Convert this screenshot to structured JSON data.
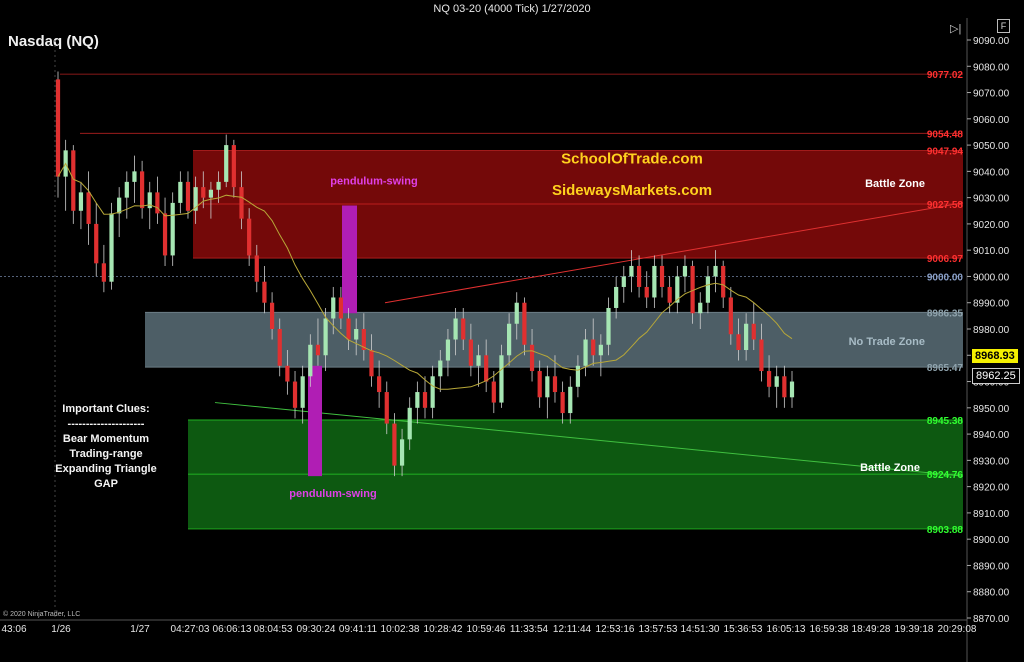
{
  "window_title": "NQ 03-20 (4000 Tick)  1/27/2020",
  "symbol_title": "Nasdaq (NQ)",
  "copyright": "© 2020 NinjaTrader, LLC",
  "header_button": "F",
  "brand": {
    "line1": "SchoolOfTrade.com",
    "line2": "SidewaysMarkets.com"
  },
  "clues": {
    "title": "Important Clues:",
    "divider": "---------------------",
    "items": [
      "Bear Momentum",
      "Trading-range",
      "Expanding Triangle",
      "GAP"
    ]
  },
  "current_prices": {
    "ma_value": "8968.93",
    "last_price": "8962.25"
  },
  "colors": {
    "background": "#000000",
    "bull_candle": "#a6e6b3",
    "bear_candle": "#e03030",
    "red_zone": "#7a0a0a",
    "gray_zone": "#5a6e78",
    "green_zone": "#0e5e12",
    "pendulum": "#b01eb4",
    "brand_text": "#ffd21e",
    "ma_line": "#b8a838"
  },
  "chart_data": {
    "type": "candlestick",
    "y_axis": {
      "min": 8870,
      "max": 9090,
      "step": 10
    },
    "y_ticks": [
      "9090.00",
      "9080.00",
      "9070.00",
      "9060.00",
      "9050.00",
      "9040.00",
      "9030.00",
      "9020.00",
      "9010.00",
      "9000.00",
      "8990.00",
      "8980.00",
      "8970.00",
      "8960.00",
      "8950.00",
      "8940.00",
      "8930.00",
      "8920.00",
      "8910.00",
      "8900.00",
      "8890.00",
      "8880.00",
      "8870.00"
    ],
    "x_labels": [
      "43:06",
      "1/26",
      "1/27",
      "04:27:03",
      "06:06:13",
      "08:04:53",
      "09:30:24",
      "09:41:11",
      "10:02:38",
      "10:28:42",
      "10:59:46",
      "11:33:54",
      "12:11:44",
      "12:53:16",
      "13:57:53",
      "14:51:30",
      "15:36:53",
      "16:05:13",
      "16:59:38",
      "18:49:28",
      "19:39:18",
      "20:29:08"
    ],
    "levels": [
      {
        "label": "9077.02",
        "value": 9077.02,
        "color": "#ff3030"
      },
      {
        "label": "9054.48",
        "value": 9054.48,
        "color": "#ff3030"
      },
      {
        "label": "9047.94",
        "value": 9047.94,
        "color": "#ff3030"
      },
      {
        "label": "9027.58",
        "value": 9027.58,
        "color": "#ff3030"
      },
      {
        "label": "9006.97",
        "value": 9006.97,
        "color": "#ff3030"
      },
      {
        "label": "9000.00",
        "value": 9000.0,
        "color": "#8aa0c8"
      },
      {
        "label": "8986.35",
        "value": 8986.35,
        "color": "#8fa3ad"
      },
      {
        "label": "8965.47",
        "value": 8965.47,
        "color": "#8fa3ad"
      },
      {
        "label": "8945.38",
        "value": 8945.38,
        "color": "#30ff30"
      },
      {
        "label": "8924.76",
        "value": 8924.76,
        "color": "#30ff30"
      },
      {
        "label": "8903.88",
        "value": 8903.88,
        "color": "#30ff30"
      }
    ],
    "zones": [
      {
        "name": "Battle Zone",
        "top": 9047.94,
        "bottom": 9006.97,
        "color": "#7a0a0a"
      },
      {
        "name": "No Trade Zone",
        "top": 8986.35,
        "bottom": 8965.47,
        "color": "#5a6e78"
      },
      {
        "name": "Battle Zone",
        "top": 8945.38,
        "bottom": 8903.88,
        "color": "#0e5e12"
      }
    ],
    "annotations": [
      "pendulum-swing",
      "pendulum-swing"
    ],
    "candles": [
      [
        9075,
        9078,
        9030,
        9038
      ],
      [
        9038,
        9052,
        9025,
        9048
      ],
      [
        9048,
        9050,
        9020,
        9025
      ],
      [
        9025,
        9036,
        9018,
        9032
      ],
      [
        9032,
        9040,
        9012,
        9020
      ],
      [
        9020,
        9028,
        9000,
        9005
      ],
      [
        9005,
        9012,
        8994,
        8998
      ],
      [
        8998,
        9028,
        8995,
        9024
      ],
      [
        9024,
        9034,
        9015,
        9030
      ],
      [
        9030,
        9040,
        9022,
        9036
      ],
      [
        9036,
        9046,
        9028,
        9040
      ],
      [
        9040,
        9044,
        9022,
        9026
      ],
      [
        9026,
        9036,
        9018,
        9032
      ],
      [
        9032,
        9038,
        9020,
        9024
      ],
      [
        9024,
        9030,
        9004,
        9008
      ],
      [
        9008,
        9032,
        9004,
        9028
      ],
      [
        9028,
        9040,
        9024,
        9036
      ],
      [
        9036,
        9040,
        9022,
        9025
      ],
      [
        9025,
        9038,
        9020,
        9034
      ],
      [
        9034,
        9040,
        9026,
        9030
      ],
      [
        9030,
        9036,
        9022,
        9033
      ],
      [
        9033,
        9040,
        9028,
        9036
      ],
      [
        9036,
        9054,
        9034,
        9050
      ],
      [
        9050,
        9052,
        9030,
        9034
      ],
      [
        9034,
        9040,
        9018,
        9022
      ],
      [
        9022,
        9026,
        9004,
        9008
      ],
      [
        9008,
        9012,
        8994,
        8998
      ],
      [
        8998,
        9004,
        8986,
        8990
      ],
      [
        8990,
        8994,
        8976,
        8980
      ],
      [
        8980,
        8984,
        8962,
        8966
      ],
      [
        8966,
        8972,
        8955,
        8960
      ],
      [
        8960,
        8964,
        8946,
        8950
      ],
      [
        8950,
        8966,
        8944,
        8962
      ],
      [
        8962,
        8978,
        8958,
        8974
      ],
      [
        8974,
        8984,
        8966,
        8970
      ],
      [
        8970,
        8988,
        8964,
        8984
      ],
      [
        8984,
        8996,
        8978,
        8992
      ],
      [
        8992,
        8996,
        8980,
        8984
      ],
      [
        8984,
        8988,
        8972,
        8976
      ],
      [
        8976,
        8984,
        8970,
        8980
      ],
      [
        8980,
        8986,
        8968,
        8972
      ],
      [
        8972,
        8978,
        8958,
        8962
      ],
      [
        8962,
        8968,
        8950,
        8956
      ],
      [
        8956,
        8960,
        8940,
        8944
      ],
      [
        8944,
        8948,
        8924,
        8928
      ],
      [
        8928,
        8942,
        8924,
        8938
      ],
      [
        8938,
        8954,
        8934,
        8950
      ],
      [
        8950,
        8960,
        8944,
        8956
      ],
      [
        8956,
        8962,
        8946,
        8950
      ],
      [
        8950,
        8966,
        8946,
        8962
      ],
      [
        8962,
        8972,
        8956,
        8968
      ],
      [
        8968,
        8980,
        8962,
        8976
      ],
      [
        8976,
        8988,
        8970,
        8984
      ],
      [
        8984,
        8988,
        8972,
        8976
      ],
      [
        8976,
        8982,
        8962,
        8966
      ],
      [
        8966,
        8974,
        8958,
        8970
      ],
      [
        8970,
        8976,
        8956,
        8960
      ],
      [
        8960,
        8964,
        8948,
        8952
      ],
      [
        8952,
        8974,
        8950,
        8970
      ],
      [
        8970,
        8986,
        8966,
        8982
      ],
      [
        8982,
        8994,
        8976,
        8990
      ],
      [
        8990,
        8992,
        8970,
        8974
      ],
      [
        8974,
        8980,
        8960,
        8964
      ],
      [
        8964,
        8968,
        8950,
        8954
      ],
      [
        8954,
        8966,
        8946,
        8962
      ],
      [
        8962,
        8970,
        8952,
        8956
      ],
      [
        8956,
        8960,
        8944,
        8948
      ],
      [
        8948,
        8962,
        8944,
        8958
      ],
      [
        8958,
        8970,
        8954,
        8966
      ],
      [
        8966,
        8980,
        8962,
        8976
      ],
      [
        8976,
        8984,
        8966,
        8970
      ],
      [
        8970,
        8978,
        8962,
        8974
      ],
      [
        8974,
        8992,
        8970,
        8988
      ],
      [
        8988,
        9000,
        8984,
        8996
      ],
      [
        8996,
        9004,
        8990,
        9000
      ],
      [
        9000,
        9010,
        8994,
        9004
      ],
      [
        9004,
        9008,
        8992,
        8996
      ],
      [
        8996,
        9002,
        8988,
        8992
      ],
      [
        8992,
        9008,
        8988,
        9004
      ],
      [
        9004,
        9008,
        8992,
        8996
      ],
      [
        8996,
        9000,
        8986,
        8990
      ],
      [
        8990,
        9004,
        8986,
        9000
      ],
      [
        9000,
        9008,
        8994,
        9004
      ],
      [
        9004,
        9006,
        8982,
        8986
      ],
      [
        8986,
        8994,
        8980,
        8990
      ],
      [
        8990,
        9004,
        8986,
        9000
      ],
      [
        9000,
        9010,
        8994,
        9004
      ],
      [
        9004,
        9006,
        8988,
        8992
      ],
      [
        8992,
        8996,
        8974,
        8978
      ],
      [
        8978,
        8984,
        8968,
        8972
      ],
      [
        8972,
        8986,
        8968,
        8982
      ],
      [
        8982,
        8990,
        8972,
        8976
      ],
      [
        8976,
        8982,
        8960,
        8964
      ],
      [
        8964,
        8970,
        8954,
        8958
      ],
      [
        8958,
        8966,
        8950,
        8962
      ],
      [
        8962,
        8966,
        8950,
        8954
      ],
      [
        8954,
        8964,
        8950,
        8960
      ]
    ]
  }
}
